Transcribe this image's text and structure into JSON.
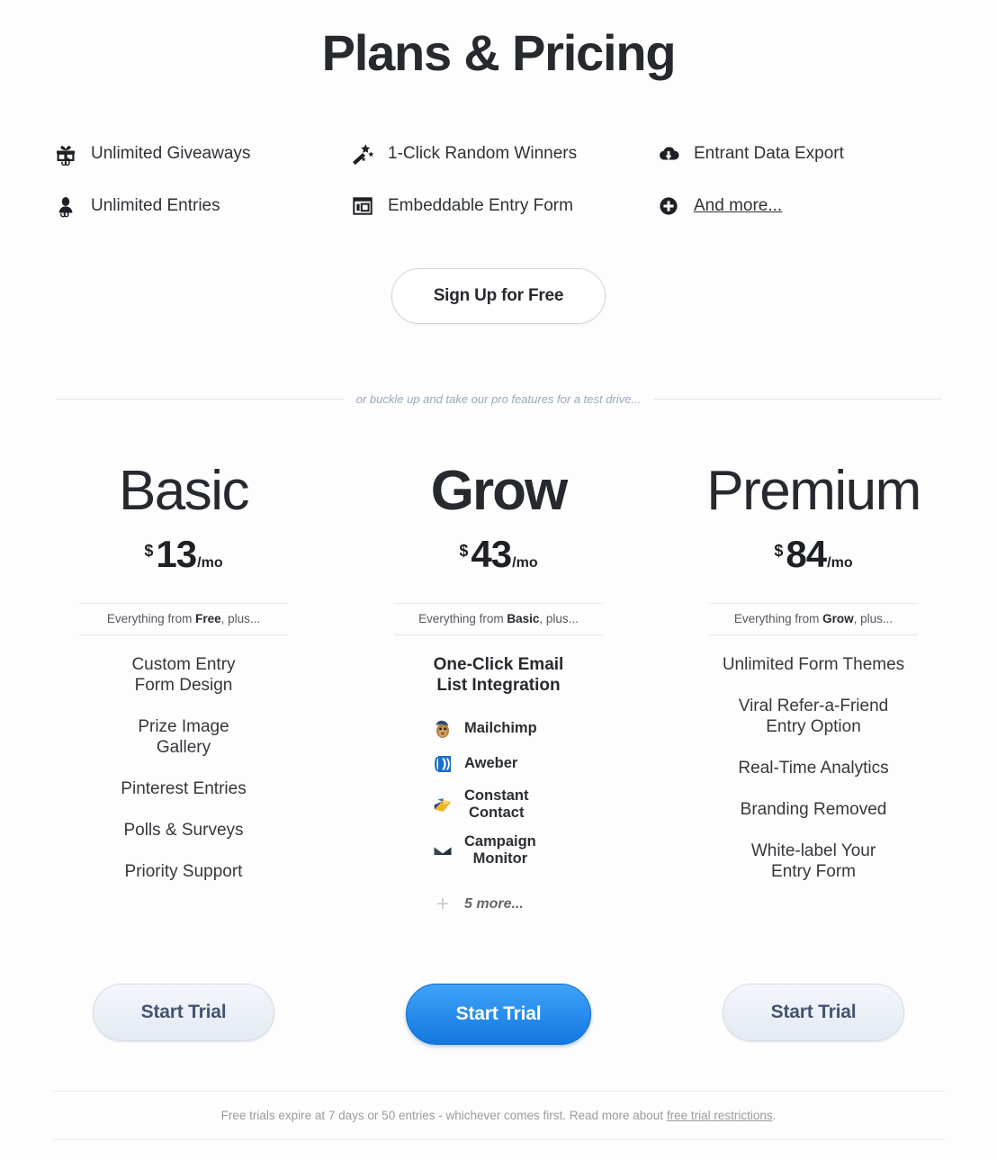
{
  "page_title": "Plans & Pricing",
  "features": [
    {
      "icon": "gift-infinity-icon",
      "label": "Unlimited Giveaways",
      "underline": false
    },
    {
      "icon": "magic-wand-icon",
      "label": "1-Click Random Winners",
      "underline": false
    },
    {
      "icon": "cloud-download-icon",
      "label": "Entrant Data Export",
      "underline": false
    },
    {
      "icon": "person-infinity-icon",
      "label": "Unlimited Entries",
      "underline": false
    },
    {
      "icon": "embed-window-icon",
      "label": "Embeddable Entry Form",
      "underline": false
    },
    {
      "icon": "plus-circle-icon",
      "label": "And more...",
      "underline": true
    }
  ],
  "signup_button": "Sign Up for Free",
  "divider_text": "or buckle up and take our pro features for a test drive...",
  "plans": [
    {
      "name": "Basic",
      "weight": "light",
      "currency": "$",
      "amount": "13",
      "period": "/mo",
      "everything_prefix": "Everything from ",
      "everything_plan": "Free",
      "everything_suffix": ", plus...",
      "features": [
        "Custom Entry\nForm Design",
        "Prize Image\nGallery",
        "Pinterest Entries",
        "Polls & Surveys",
        "Priority Support"
      ],
      "cta": "Start Trial",
      "cta_style": "gray"
    },
    {
      "name": "Grow",
      "weight": "black",
      "currency": "$",
      "amount": "43",
      "period": "/mo",
      "everything_prefix": "Everything from ",
      "everything_plan": "Basic",
      "everything_suffix": ", plus...",
      "headline": "One-Click Email\nList Integration",
      "integrations": [
        {
          "logo": "mailchimp-logo",
          "label": "Mailchimp"
        },
        {
          "logo": "aweber-logo",
          "label": "Aweber"
        },
        {
          "logo": "constant-contact-logo",
          "label": "Constant\nContact"
        },
        {
          "logo": "campaign-monitor-logo",
          "label": "Campaign\nMonitor"
        }
      ],
      "more_label": "5 more...",
      "cta": "Start Trial",
      "cta_style": "blue"
    },
    {
      "name": "Premium",
      "weight": "light",
      "currency": "$",
      "amount": "84",
      "period": "/mo",
      "everything_prefix": "Everything from ",
      "everything_plan": "Grow",
      "everything_suffix": ", plus...",
      "features": [
        "Unlimited Form Themes",
        "Viral Refer-a-Friend\nEntry Option",
        "Real-Time Analytics",
        "Branding Removed",
        "White-label Your\nEntry Form"
      ],
      "cta": "Start Trial",
      "cta_style": "gray"
    }
  ],
  "footer": {
    "text_before": "Free trials expire at 7 days or 50 entries - whichever comes first. Read more about ",
    "link": "free trial restrictions",
    "text_after": "."
  },
  "colors": {
    "accent_blue": "#1278e0",
    "text_dark": "#26292e",
    "muted": "#999c9f",
    "divider_blue": "#9aa7bd"
  }
}
